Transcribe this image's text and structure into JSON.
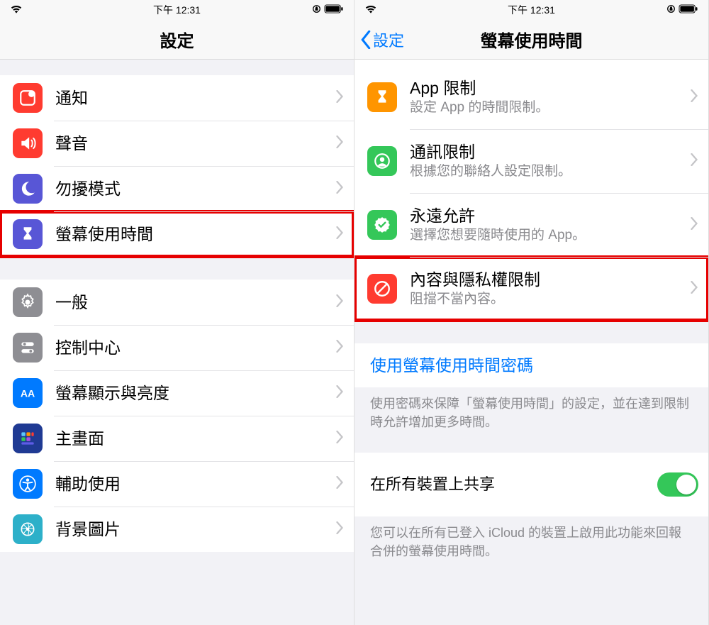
{
  "status": {
    "time": "下午 12:31"
  },
  "left": {
    "title": "設定",
    "items": [
      {
        "label": "通知"
      },
      {
        "label": "聲音"
      },
      {
        "label": "勿擾模式"
      },
      {
        "label": "螢幕使用時間"
      },
      {
        "label": "一般"
      },
      {
        "label": "控制中心"
      },
      {
        "label": "螢幕顯示與亮度"
      },
      {
        "label": "主畫面"
      },
      {
        "label": "輔助使用"
      },
      {
        "label": "背景圖片"
      }
    ]
  },
  "right": {
    "back": "設定",
    "title": "螢幕使用時間",
    "items": [
      {
        "title": "App 限制",
        "sub": "設定 App 的時間限制。"
      },
      {
        "title": "通訊限制",
        "sub": "根據您的聯絡人設定限制。"
      },
      {
        "title": "永遠允許",
        "sub": "選擇您想要隨時使用的 App。"
      },
      {
        "title": "內容與隱私權限制",
        "sub": "阻擋不當內容。"
      }
    ],
    "passcode_link": "使用螢幕使用時間密碼",
    "passcode_footer": "使用密碼來保障「螢幕使用時間」的設定，並在達到限制時允許增加更多時間。",
    "share_label": "在所有裝置上共享",
    "share_footer": "您可以在所有已登入 iCloud 的裝置上啟用此功能來回報合併的螢幕使用時間。"
  }
}
